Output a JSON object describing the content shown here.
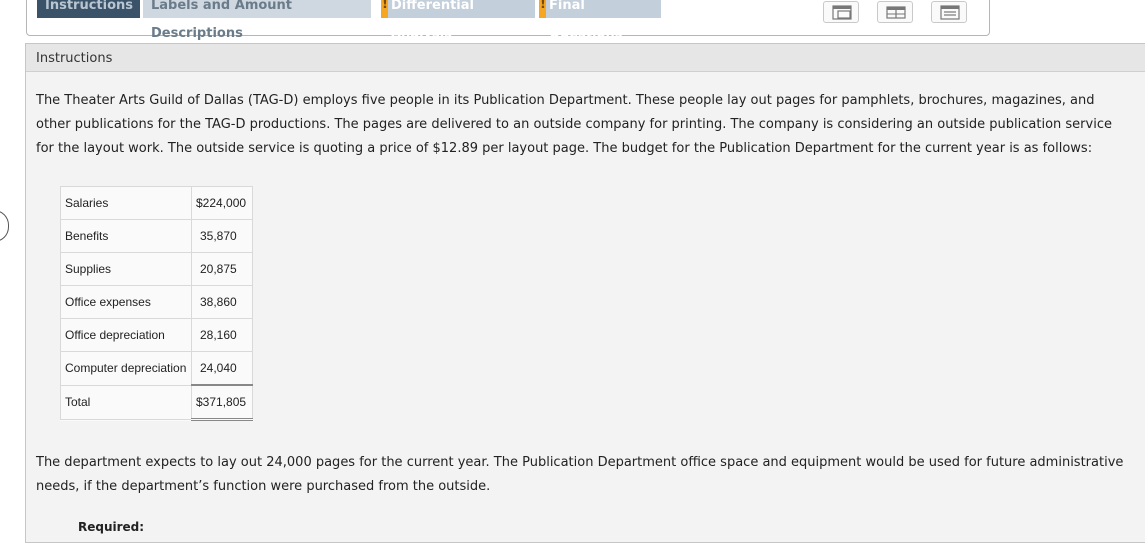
{
  "tabs": [
    {
      "label": "Instructions",
      "warning": false
    },
    {
      "label": "Labels and Amount Descriptions",
      "warning": false
    },
    {
      "label": "Differential Analysis",
      "warning": true
    },
    {
      "label": "Final Questions",
      "warning": true
    }
  ],
  "view_buttons": [
    "window-view-icon",
    "split-view-icon",
    "list-view-icon"
  ],
  "panel": {
    "title": "Instructions",
    "intro": "The Theater Arts Guild of Dallas (TAG-D) employs five people in its Publication Department. These people lay out pages for pamphlets, brochures, magazines, and other publications for the TAG-D productions. The pages are delivered to an outside company for printing. The company is considering an outside publication service for the layout work. The outside service is quoting a price of $12.89 per layout page. The budget for the Publication Department for the current year is as follows:",
    "budget": [
      {
        "label": "Salaries",
        "amount": "$224,000"
      },
      {
        "label": "Benefits",
        "amount": "35,870"
      },
      {
        "label": "Supplies",
        "amount": "20,875"
      },
      {
        "label": "Office expenses",
        "amount": "38,860"
      },
      {
        "label": "Office depreciation",
        "amount": "28,160"
      },
      {
        "label": "Computer depreciation",
        "amount": "24,040"
      }
    ],
    "total": {
      "label": "Total",
      "amount": "$371,805"
    },
    "followup": "The department expects to lay out 24,000 pages for the current year. The Publication Department office space and equipment would be used for future administrative needs, if the department’s function were purchased from the outside.",
    "required_label": "Required:"
  },
  "colors": {
    "active_tab": "#3b5369",
    "warning": "#f5a623",
    "close": "#e0533c"
  }
}
